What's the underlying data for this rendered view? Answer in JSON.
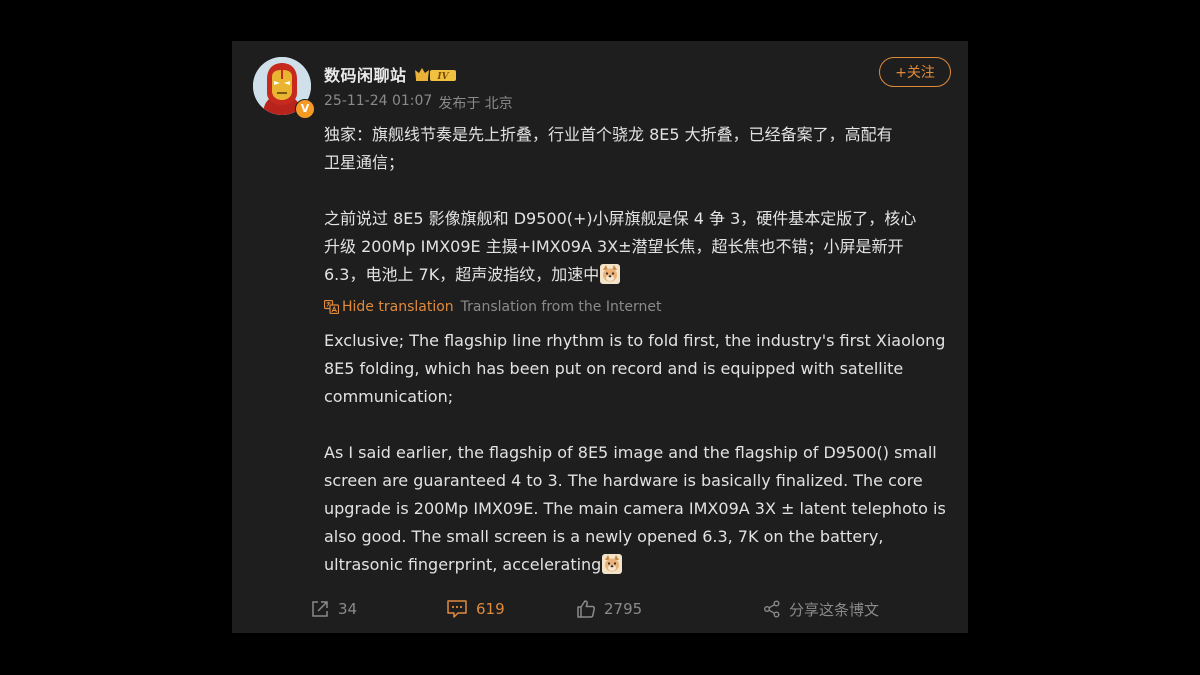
{
  "post": {
    "author": {
      "name": "数码闲聊站",
      "level_badge": "IV",
      "verified_mark": "V"
    },
    "timestamp": "25-11-24 01:07",
    "location": "发布于 北京",
    "follow_label": "+关注",
    "original_text": "独家：旗舰线节奏是先上折叠，行业首个骁龙 8E5 大折叠，已经备案了，高配有\n卫星通信；\n\n之前说过 8E5 影像旗舰和 D9500(+)小屏旗舰是保 4 争 3，硬件基本定版了，核心\n升级 200Mp IMX09E 主摄+IMX09A 3X±潜望长焦，超长焦也不错；小屏是新开\n6.3，电池上 7K，超声波指纹，加速中",
    "hide_translation_label": "Hide translation",
    "translation_source": "Translation from the Internet",
    "translated_text": "Exclusive; The flagship line rhythm is to fold first, the industry's first Xiaolong\n8E5 folding, which has been put on record and is equipped with satellite\ncommunication;\n\nAs I said earlier, the flagship of 8E5 image and the flagship of D9500() small\nscreen are guaranteed 4 to 3. The hardware is basically finalized. The core\nupgrade is 200Mp IMX09E. The main camera IMX09A 3X ± latent telephoto is\nalso good. The small screen is a newly opened 6.3, 7K on the battery,\nultrasonic fingerprint, accelerating",
    "inline_emoji": "doge-face-icon",
    "actions": {
      "reposts": "34",
      "comments": "619",
      "likes": "2795",
      "share_label": "分享这条博文"
    }
  },
  "colors": {
    "page_background": "#000000",
    "card_background": "#1e1e1e",
    "accent": "#e08a3c",
    "text_primary": "#e2e2e2",
    "text_secondary": "#8a8a8a",
    "verified_badge": "#f59a23"
  },
  "icons": [
    "avatar-ironman",
    "crown-icon",
    "translate-icon",
    "repost-icon",
    "comment-icon",
    "like-icon",
    "share-icon",
    "doge-face-icon"
  ]
}
